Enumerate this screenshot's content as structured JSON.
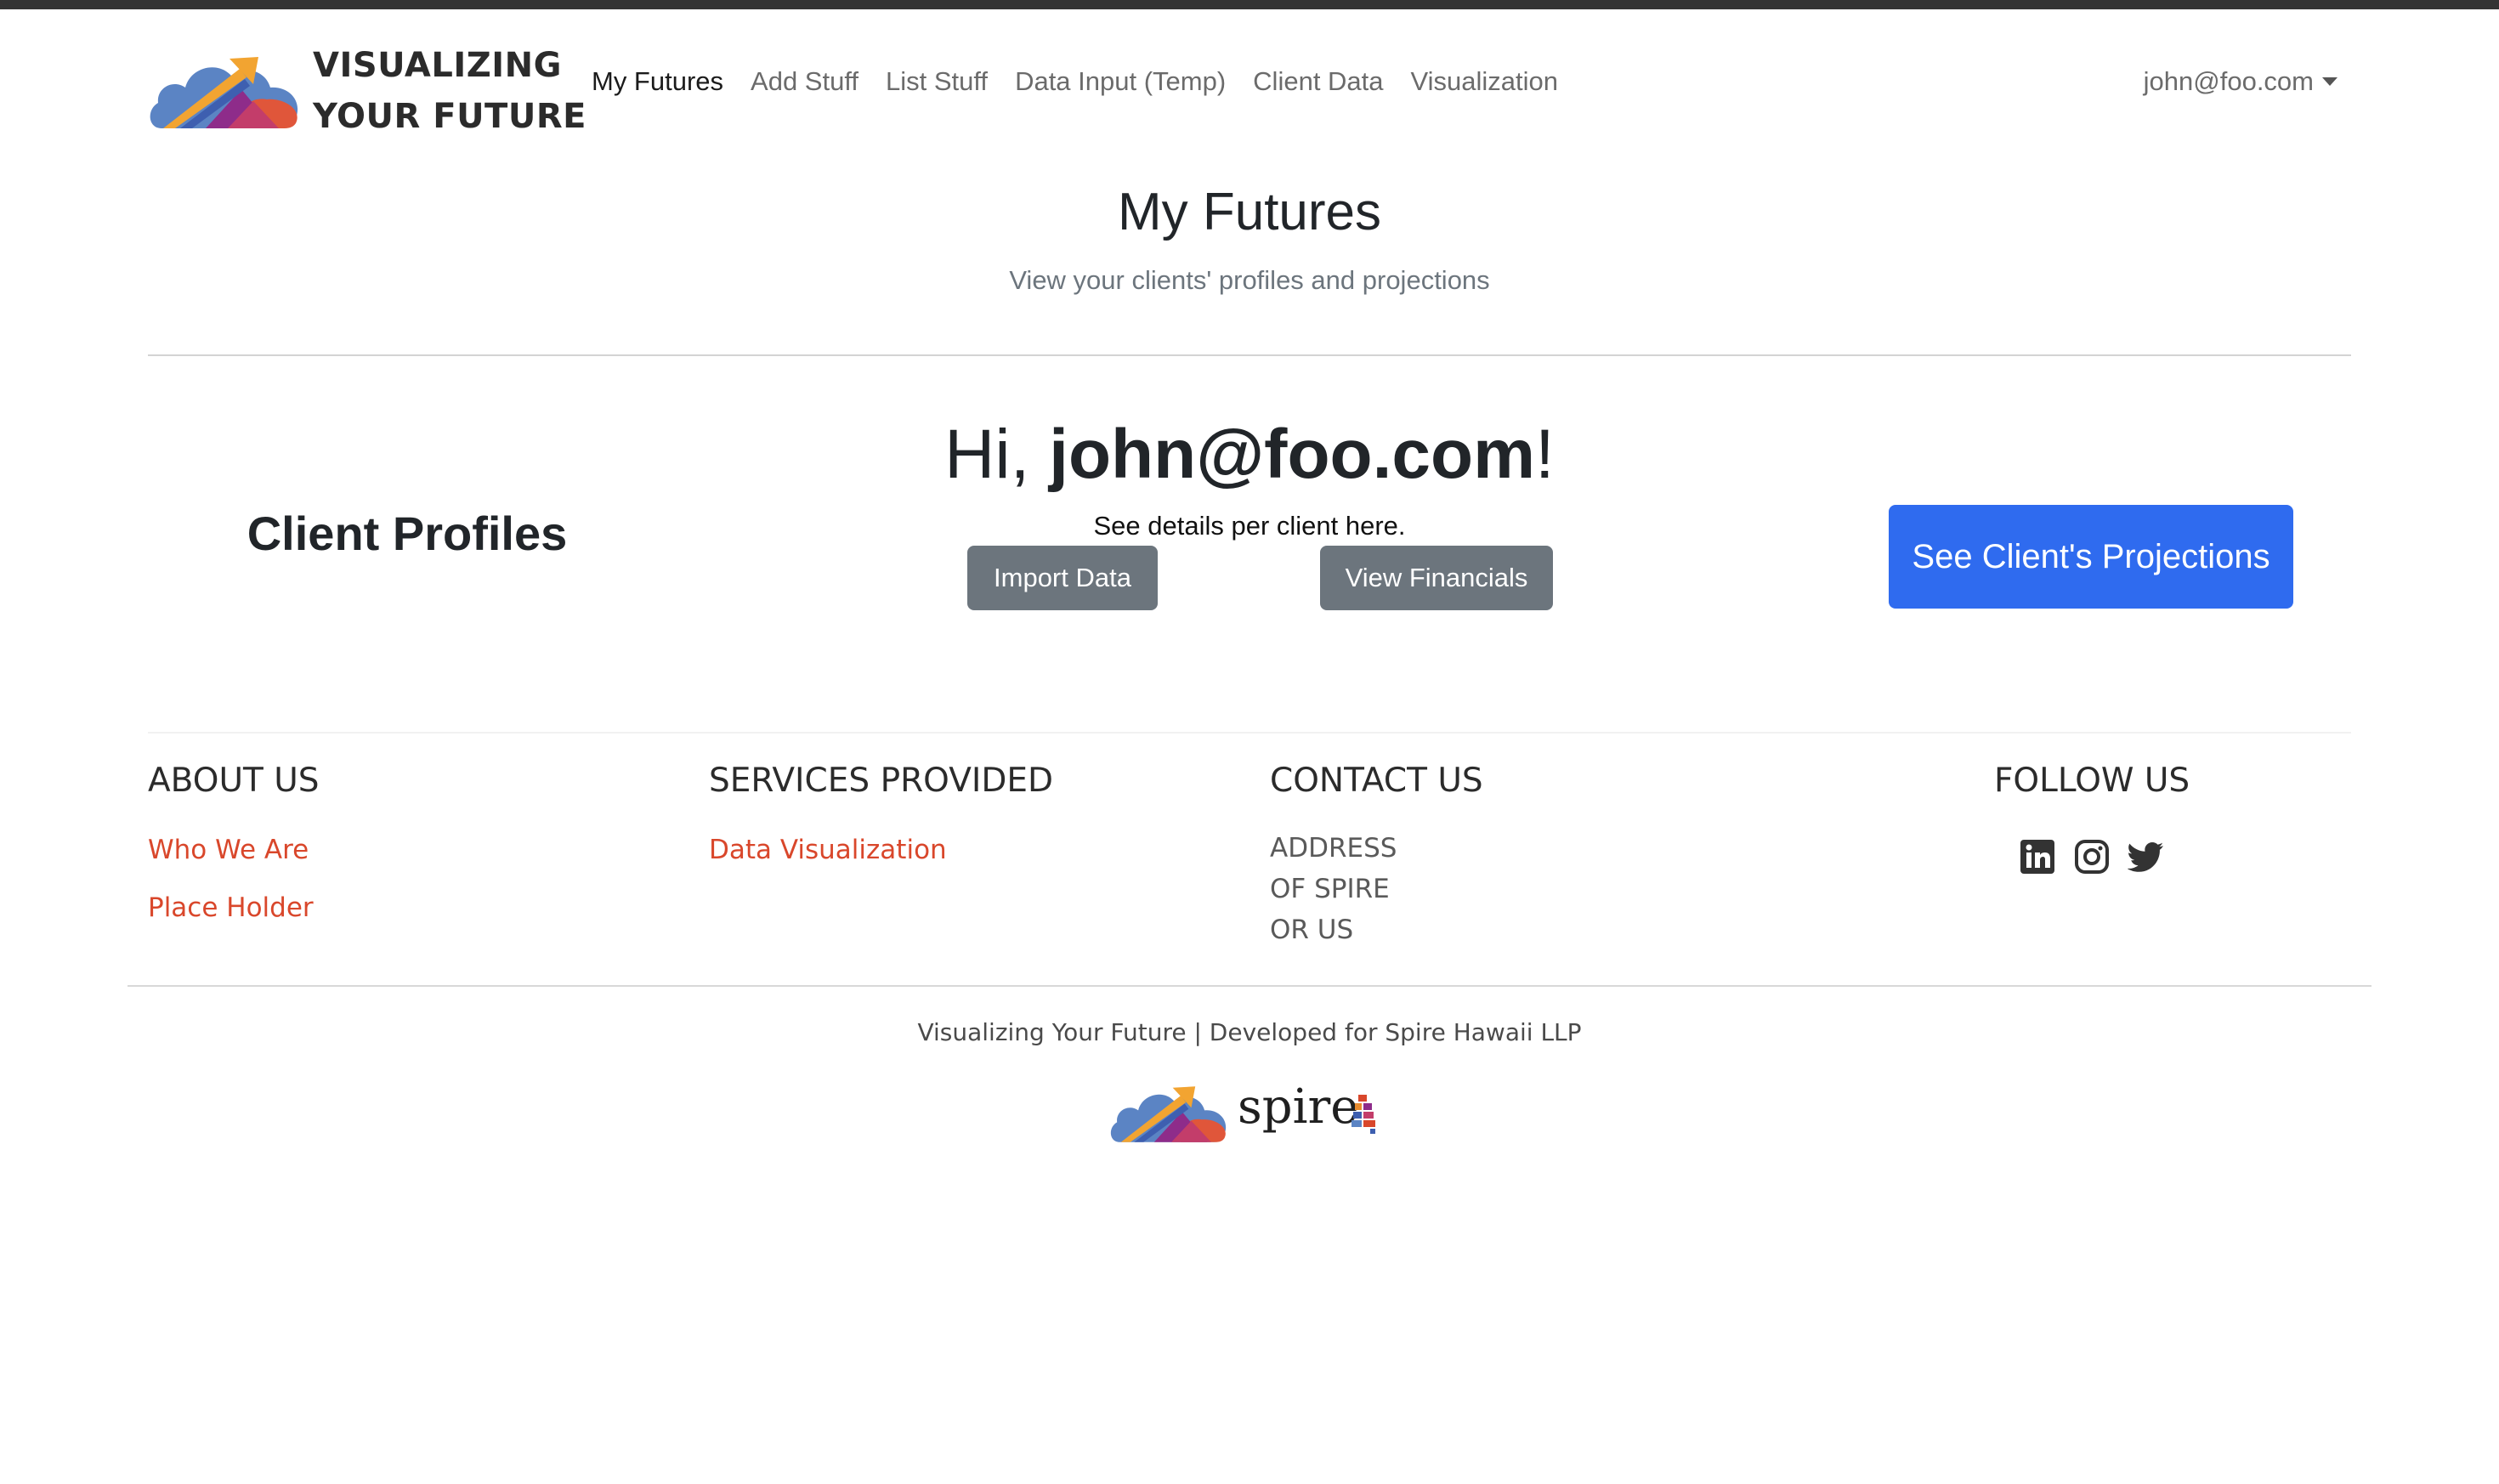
{
  "navbar": {
    "brand_line1": "VISUALIZING",
    "brand_line2": "YOUR FUTURE",
    "links": [
      "My Futures",
      "Add Stuff",
      "List Stuff",
      "Data Input (Temp)",
      "Client Data",
      "Visualization"
    ],
    "active_link": "My Futures",
    "user_email": "john@foo.com"
  },
  "header": {
    "title": "My Futures",
    "subtitle": "View your clients' profiles and projections"
  },
  "main": {
    "profiles_heading": "Client Profiles",
    "greeting_prefix": "Hi, ",
    "greeting_user": "john@foo.com",
    "greeting_suffix": "!",
    "details_text": "See details per client here.",
    "import_button": "Import Data",
    "financials_button": "View Financials",
    "projections_button": "See Client's Projections"
  },
  "footer": {
    "about": {
      "heading": "ABOUT US",
      "links": [
        "Who We Are",
        "Place Holder"
      ]
    },
    "services": {
      "heading": "SERVICES PROVIDED",
      "links": [
        "Data Visualization"
      ]
    },
    "contact": {
      "heading": "CONTACT US",
      "address_lines": [
        "ADDRESS",
        "OF SPIRE",
        "OR US"
      ]
    },
    "follow": {
      "heading": "FOLLOW US",
      "icons": [
        "linkedin-icon",
        "instagram-icon",
        "twitter-icon"
      ]
    },
    "copyright": "Visualizing Your Future | Developed for Spire Hawaii LLP",
    "partner_name": "spire"
  },
  "colors": {
    "primary_button": "#2f6bef",
    "secondary_button": "#6c757d",
    "footer_link": "#d9472b",
    "top_bar": "#343434"
  }
}
